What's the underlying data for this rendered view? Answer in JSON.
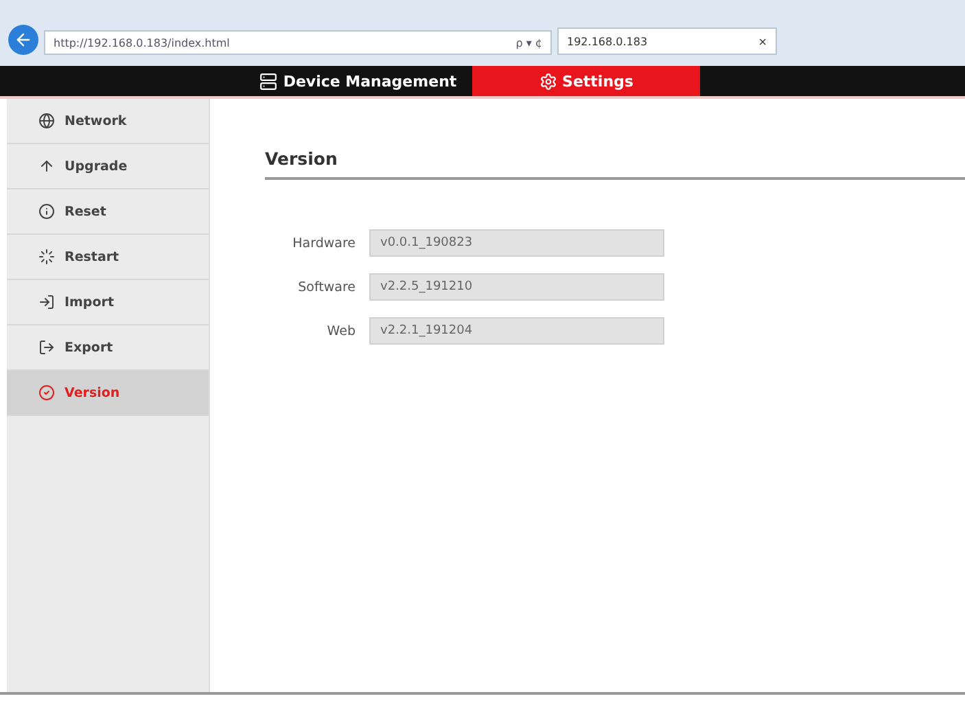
{
  "browser": {
    "address": "http://192.168.0.183/index.html",
    "search_glyph": "ρ ▾ ¢",
    "tab_title": "192.168.0.183",
    "tab_close": "×"
  },
  "nav": [
    {
      "label": "Device Management",
      "selected": false
    },
    {
      "label": "Settings",
      "selected": true
    }
  ],
  "sidebar": {
    "items": [
      {
        "label": "Network",
        "selected": false
      },
      {
        "label": "Upgrade",
        "selected": false
      },
      {
        "label": "Reset",
        "selected": false
      },
      {
        "label": "Restart",
        "selected": false
      },
      {
        "label": "Import",
        "selected": false
      },
      {
        "label": "Export",
        "selected": false
      },
      {
        "label": "Version",
        "selected": true
      }
    ]
  },
  "section": {
    "title": "Version",
    "fields": [
      {
        "label": "Hardware",
        "value": "v0.0.1_190823"
      },
      {
        "label": "Software",
        "value": "v2.2.5_191210"
      },
      {
        "label": "Web",
        "value": "v2.2.1_191204"
      }
    ]
  }
}
